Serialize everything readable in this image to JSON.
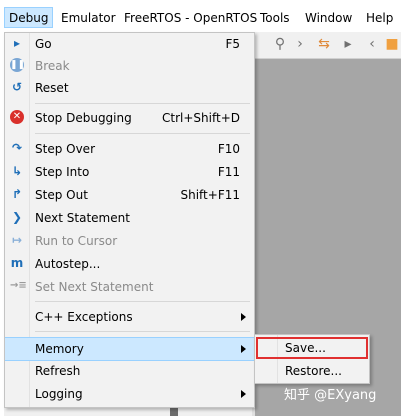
{
  "menubar": {
    "items": [
      {
        "label": "Debug",
        "active": true
      },
      {
        "label": "Emulator"
      },
      {
        "label": "FreeRTOS - OpenRTOS"
      },
      {
        "label": "Tools"
      },
      {
        "label": "Window"
      },
      {
        "label": "Help"
      }
    ]
  },
  "toolbar": {
    "icons": [
      "search-icon",
      "arrow-split-icon",
      "step-marker-icon",
      "back-arrow-icon",
      "bookmark-icon"
    ]
  },
  "debug_menu": {
    "items": [
      {
        "label": "Go",
        "shortcut": "F5",
        "icon": "play-icon",
        "enabled": true
      },
      {
        "label": "Break",
        "shortcut": "",
        "icon": "pause-icon",
        "enabled": false
      },
      {
        "label": "Reset",
        "shortcut": "",
        "icon": "reset-icon",
        "enabled": true
      },
      {
        "label": "Stop Debugging",
        "shortcut": "Ctrl+Shift+D",
        "icon": "stop-icon",
        "enabled": true
      },
      {
        "label": "Step Over",
        "shortcut": "F10",
        "icon": "step-over-icon",
        "enabled": true
      },
      {
        "label": "Step Into",
        "shortcut": "F11",
        "icon": "step-into-icon",
        "enabled": true
      },
      {
        "label": "Step Out",
        "shortcut": "Shift+F11",
        "icon": "step-out-icon",
        "enabled": true
      },
      {
        "label": "Next Statement",
        "shortcut": "",
        "icon": "next-statement-icon",
        "enabled": true
      },
      {
        "label": "Run to Cursor",
        "shortcut": "",
        "icon": "run-to-cursor-icon",
        "enabled": false
      },
      {
        "label": "Autostep...",
        "shortcut": "",
        "icon": "autostep-icon",
        "enabled": true
      },
      {
        "label": "Set Next Statement",
        "shortcut": "",
        "icon": "set-next-statement-icon",
        "enabled": false
      },
      {
        "label": "C++ Exceptions",
        "shortcut": "",
        "submenu": true,
        "enabled": true
      },
      {
        "label": "Memory",
        "shortcut": "",
        "submenu": true,
        "enabled": true,
        "highlighted": true
      },
      {
        "label": "Refresh",
        "shortcut": "",
        "enabled": true
      },
      {
        "label": "Logging",
        "shortcut": "",
        "submenu": true,
        "enabled": true
      }
    ]
  },
  "memory_submenu": {
    "items": [
      {
        "label": "Save..."
      },
      {
        "label": "Restore..."
      }
    ]
  },
  "watermark": "知乎 @EXyang",
  "colors": {
    "highlight": "#cce8ff",
    "highlight_border": "#99d1ff",
    "callout_box": "#e03030",
    "stop_red": "#d9302b",
    "icon_blue": "#1f6fb8"
  }
}
